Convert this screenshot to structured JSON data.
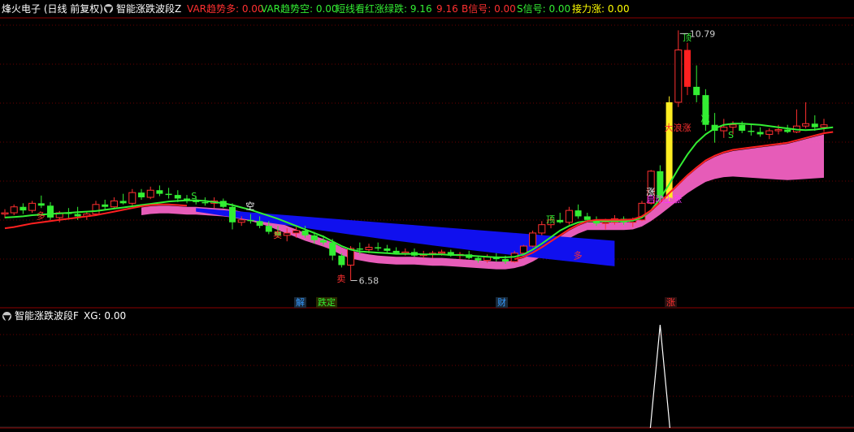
{
  "main_header": {
    "stock": "烽火电子 (日线 前复权)",
    "indicator": "智能涨跌波段Z",
    "items": [
      {
        "label": "VAR趋势多: 0.00",
        "color": "#ff3030"
      },
      {
        "label": "VAR趋势空: 0.00",
        "color": "#33ee33"
      },
      {
        "label": "短线看红涨绿跌: 9.16",
        "color": "#33ee33"
      },
      {
        "label": "9.16",
        "color": "#ff3030"
      },
      {
        "label": "B信号: 0.00",
        "color": "#ff3030"
      },
      {
        "label": "S信号: 0.00",
        "color": "#33ee33"
      },
      {
        "label": "接力涨: 0.00",
        "color": "#ffff00"
      }
    ]
  },
  "sub_header": {
    "indicator": "智能涨跌波段F",
    "xg": "XG: 0.00"
  },
  "markers": {
    "high_label": "10.79",
    "low_label": "6.58",
    "bottom_tags": [
      "解",
      "跌定",
      "财",
      "涨"
    ],
    "chart_labels": [
      "多",
      "空",
      "S",
      "顶",
      "顶",
      "减",
      "S",
      "涨",
      "启动上涨",
      "大浪涨",
      "多",
      "卖",
      "卖"
    ]
  },
  "chart_data": {
    "type": "candlestick",
    "ohlc": [
      [
        7.7,
        7.78,
        7.63,
        7.72
      ],
      [
        7.72,
        7.86,
        7.68,
        7.82
      ],
      [
        7.82,
        7.88,
        7.7,
        7.76
      ],
      [
        7.76,
        7.92,
        7.72,
        7.88
      ],
      [
        7.88,
        8.01,
        7.8,
        7.84
      ],
      [
        7.84,
        7.9,
        7.6,
        7.64
      ],
      [
        7.64,
        7.75,
        7.56,
        7.72
      ],
      [
        7.72,
        7.8,
        7.62,
        7.7
      ],
      [
        7.7,
        7.82,
        7.6,
        7.66
      ],
      [
        7.66,
        7.74,
        7.6,
        7.7
      ],
      [
        7.7,
        7.92,
        7.68,
        7.86
      ],
      [
        7.86,
        7.94,
        7.78,
        7.82
      ],
      [
        7.82,
        7.98,
        7.8,
        7.92
      ],
      [
        7.92,
        8.04,
        7.86,
        7.88
      ],
      [
        7.88,
        8.12,
        7.84,
        8.06
      ],
      [
        8.06,
        8.12,
        7.94,
        7.98
      ],
      [
        7.98,
        8.16,
        7.95,
        8.1
      ],
      [
        8.1,
        8.18,
        8.0,
        8.04
      ],
      [
        8.04,
        8.14,
        7.96,
        8.02
      ],
      [
        8.02,
        8.1,
        7.9,
        7.96
      ],
      [
        7.96,
        8.02,
        7.88,
        7.94
      ],
      [
        7.94,
        8.0,
        7.86,
        7.9
      ],
      [
        7.9,
        7.98,
        7.84,
        7.88
      ],
      [
        7.88,
        7.98,
        7.8,
        7.92
      ],
      [
        7.92,
        7.96,
        7.8,
        7.82
      ],
      [
        7.82,
        7.88,
        7.44,
        7.56
      ],
      [
        7.56,
        7.66,
        7.5,
        7.6
      ],
      [
        7.6,
        7.7,
        7.54,
        7.58
      ],
      [
        7.58,
        7.66,
        7.46,
        7.5
      ],
      [
        7.5,
        7.58,
        7.36,
        7.4
      ],
      [
        7.4,
        7.5,
        7.3,
        7.34
      ],
      [
        7.34,
        7.46,
        7.24,
        7.38
      ],
      [
        7.38,
        7.48,
        7.3,
        7.42
      ],
      [
        7.42,
        7.5,
        7.3,
        7.34
      ],
      [
        7.34,
        7.4,
        7.2,
        7.26
      ],
      [
        7.26,
        7.34,
        7.18,
        7.22
      ],
      [
        7.22,
        7.28,
        6.92,
        7.0
      ],
      [
        7.0,
        7.04,
        6.8,
        6.84
      ],
      [
        6.84,
        7.16,
        6.58,
        7.12
      ],
      [
        7.12,
        7.22,
        7.02,
        7.1
      ],
      [
        7.1,
        7.2,
        7.04,
        7.14
      ],
      [
        7.14,
        7.22,
        7.08,
        7.12
      ],
      [
        7.12,
        7.18,
        7.04,
        7.08
      ],
      [
        7.08,
        7.14,
        7.02,
        7.04
      ],
      [
        7.04,
        7.12,
        7.0,
        7.06
      ],
      [
        7.06,
        7.12,
        6.98,
        7.0
      ],
      [
        7.0,
        7.08,
        6.96,
        7.02
      ],
      [
        7.02,
        7.08,
        6.96,
        7.04
      ],
      [
        7.04,
        7.1,
        7.0,
        7.06
      ],
      [
        7.06,
        7.1,
        6.98,
        7.0
      ],
      [
        7.0,
        7.06,
        6.94,
        7.02
      ],
      [
        7.02,
        7.08,
        6.94,
        6.96
      ],
      [
        6.96,
        7.0,
        6.88,
        6.92
      ],
      [
        6.92,
        7.02,
        6.88,
        6.98
      ],
      [
        6.98,
        7.04,
        6.9,
        6.94
      ],
      [
        6.94,
        7.0,
        6.86,
        6.9
      ],
      [
        6.9,
        7.08,
        6.88,
        7.04
      ],
      [
        7.04,
        7.18,
        7.02,
        7.16
      ],
      [
        7.16,
        7.42,
        7.14,
        7.38
      ],
      [
        7.38,
        7.58,
        7.34,
        7.52
      ],
      [
        7.52,
        7.66,
        7.46,
        7.6
      ],
      [
        7.6,
        7.72,
        7.54,
        7.56
      ],
      [
        7.56,
        7.82,
        7.52,
        7.76
      ],
      [
        7.76,
        7.86,
        7.62,
        7.66
      ],
      [
        7.66,
        7.72,
        7.56,
        7.6
      ],
      [
        7.6,
        7.66,
        7.5,
        7.54
      ],
      [
        7.54,
        7.62,
        7.44,
        7.56
      ],
      [
        7.56,
        7.68,
        7.52,
        7.62
      ],
      [
        7.62,
        7.66,
        7.52,
        7.56
      ],
      [
        7.56,
        7.64,
        7.48,
        7.6
      ],
      [
        7.6,
        7.92,
        7.58,
        7.88
      ],
      [
        7.88,
        8.44,
        7.86,
        8.42
      ],
      [
        8.42,
        8.52,
        7.9,
        7.96
      ],
      [
        7.96,
        9.68,
        7.92,
        9.58
      ],
      [
        9.58,
        10.79,
        9.5,
        10.46
      ],
      [
        10.46,
        10.58,
        9.7,
        9.84
      ],
      [
        9.84,
        10.2,
        9.58,
        9.7
      ],
      [
        9.7,
        9.8,
        9.1,
        9.2
      ],
      [
        9.2,
        9.4,
        8.9,
        9.1
      ],
      [
        9.1,
        9.3,
        8.98,
        9.16
      ],
      [
        9.16,
        9.26,
        9.04,
        9.2
      ],
      [
        9.2,
        9.26,
        9.06,
        9.1
      ],
      [
        9.1,
        9.2,
        9.02,
        9.08
      ],
      [
        9.08,
        9.16,
        9.0,
        9.04
      ],
      [
        9.04,
        9.14,
        8.96,
        9.1
      ],
      [
        9.1,
        9.2,
        9.04,
        9.12
      ],
      [
        9.12,
        9.2,
        9.06,
        9.08
      ],
      [
        9.08,
        9.46,
        9.06,
        9.18
      ],
      [
        9.18,
        9.58,
        9.14,
        9.22
      ],
      [
        9.22,
        9.36,
        9.1,
        9.16
      ],
      [
        9.16,
        9.3,
        9.08,
        9.2
      ]
    ],
    "red_line": [
      7.46,
      7.48,
      7.51,
      7.54,
      7.56,
      7.58,
      7.6,
      7.62,
      7.64,
      7.66,
      7.68,
      7.71,
      7.74,
      7.77,
      7.8,
      7.83,
      7.85,
      7.86,
      7.86,
      7.85,
      7.84,
      7.84,
      7.83,
      7.82,
      7.81,
      7.79,
      7.76,
      7.73,
      7.69,
      7.64,
      7.58,
      7.52,
      7.46,
      7.4,
      7.35,
      7.3,
      7.24,
      7.18,
      7.12,
      7.07,
      7.04,
      7.02,
      7.01,
      7.0,
      7.0,
      7.0,
      6.99,
      6.98,
      6.98,
      6.97,
      6.96,
      6.95,
      6.94,
      6.93,
      6.92,
      6.92,
      6.94,
      6.98,
      7.05,
      7.14,
      7.24,
      7.34,
      7.44,
      7.52,
      7.58,
      7.6,
      7.6,
      7.6,
      7.6,
      7.61,
      7.66,
      7.76,
      7.9,
      8.05,
      8.2,
      8.35,
      8.48,
      8.6,
      8.68,
      8.74,
      8.78,
      8.8,
      8.82,
      8.84,
      8.86,
      8.88,
      8.9,
      8.94,
      8.98,
      9.02,
      9.06,
      9.08
    ],
    "green_line": [
      7.64,
      7.65,
      7.66,
      7.68,
      7.69,
      7.7,
      7.71,
      7.72,
      7.73,
      7.74,
      7.75,
      7.77,
      7.79,
      7.81,
      7.83,
      7.85,
      7.87,
      7.89,
      7.91,
      7.92,
      7.93,
      7.93,
      7.92,
      7.9,
      7.88,
      7.85,
      7.81,
      7.77,
      7.72,
      7.67,
      7.62,
      7.56,
      7.5,
      7.44,
      7.38,
      7.32,
      7.24,
      7.16,
      7.1,
      7.07,
      7.06,
      7.05,
      7.04,
      7.03,
      7.03,
      7.03,
      7.02,
      7.02,
      7.02,
      7.01,
      7.01,
      7.0,
      6.99,
      6.98,
      6.97,
      6.97,
      6.98,
      7.02,
      7.1,
      7.2,
      7.31,
      7.42,
      7.5,
      7.56,
      7.58,
      7.58,
      7.58,
      7.58,
      7.58,
      7.59,
      7.64,
      7.76,
      7.96,
      8.2,
      8.46,
      8.7,
      8.9,
      9.04,
      9.14,
      9.2,
      9.22,
      9.22,
      9.21,
      9.2,
      9.18,
      9.16,
      9.14,
      9.12,
      9.11,
      9.12,
      9.14,
      9.16
    ],
    "pink_band": {
      "start_index": 15,
      "end_index": 91
    },
    "blue_band": {
      "start_index": 21,
      "end_index": 67
    },
    "y_range": [
      6.45,
      11.0
    ],
    "xg_signal": {
      "spike_index": 72,
      "value": 1
    }
  }
}
